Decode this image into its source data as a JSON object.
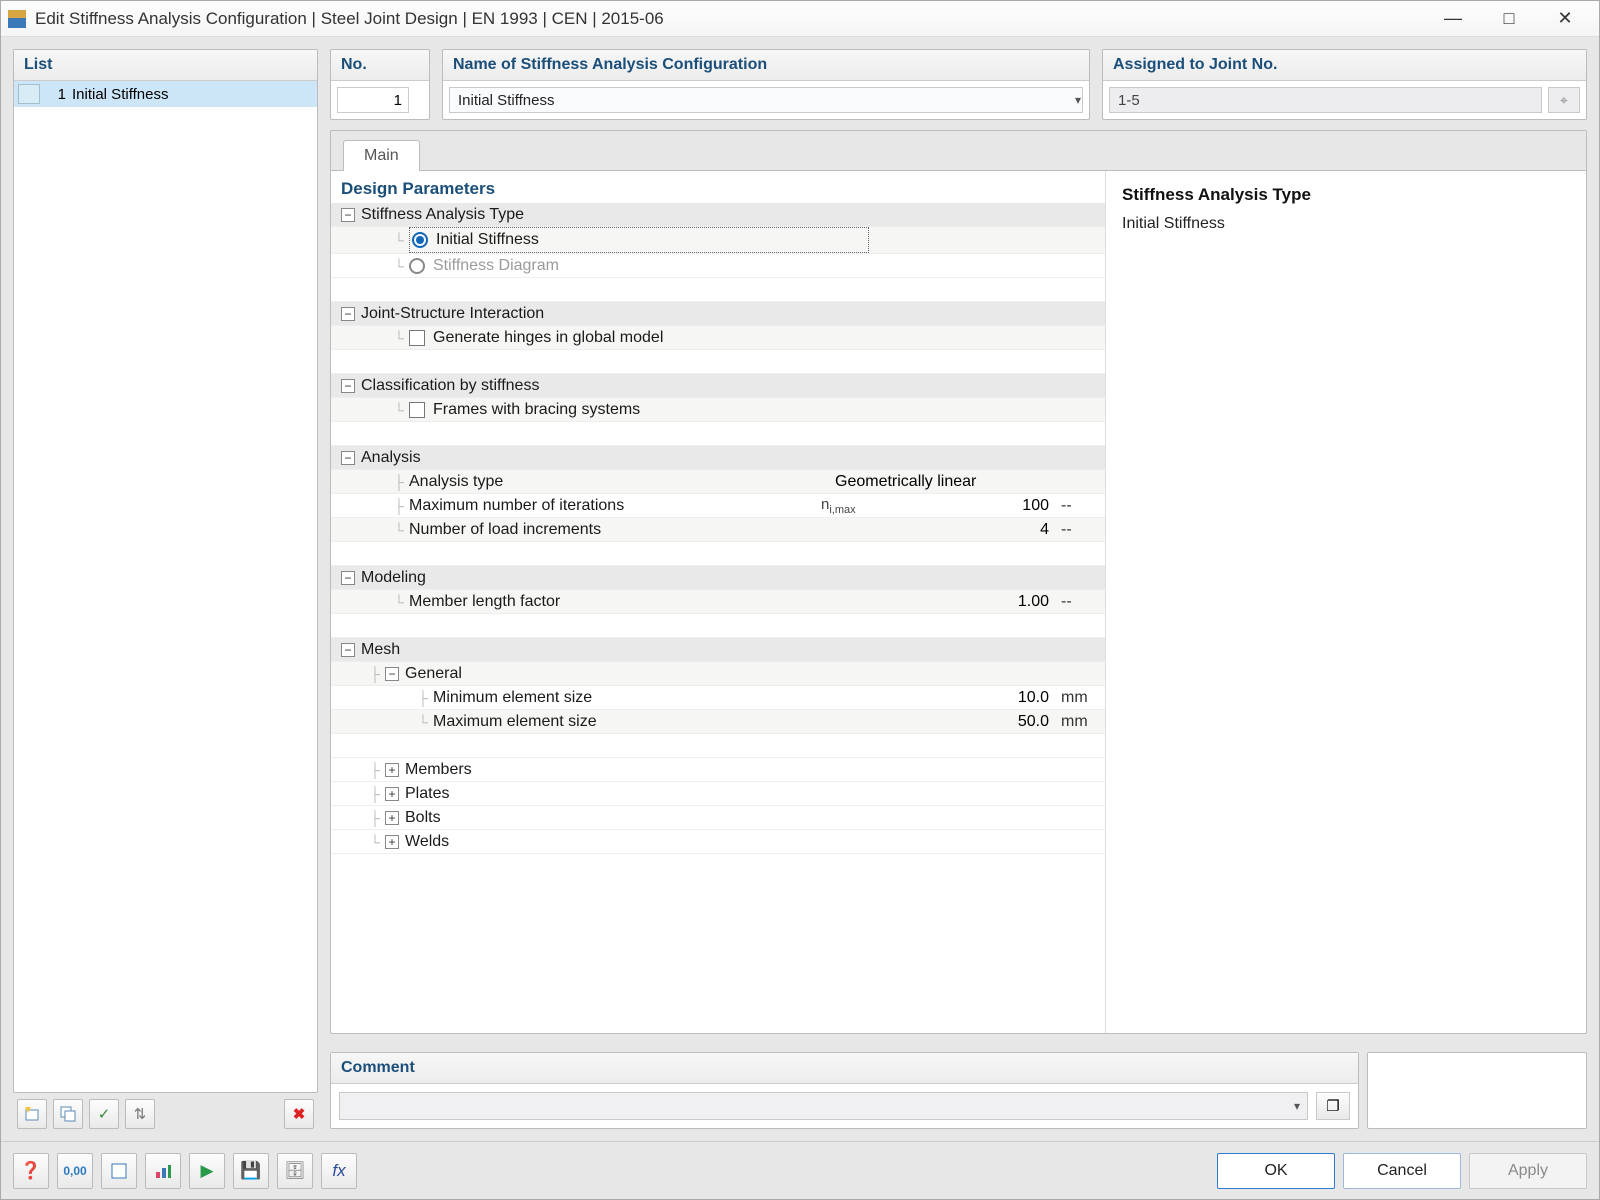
{
  "window": {
    "title": "Edit Stiffness Analysis Configuration | Steel Joint Design | EN 1993 | CEN | 2015-06"
  },
  "left": {
    "header": "List",
    "items": [
      {
        "no": "1",
        "label": "Initial Stiffness"
      }
    ]
  },
  "no": {
    "header": "No.",
    "value": "1"
  },
  "name": {
    "header": "Name of Stiffness Analysis Configuration",
    "value": "Initial Stiffness"
  },
  "assigned": {
    "header": "Assigned to Joint No.",
    "value": "1-5"
  },
  "tabs": {
    "main": "Main"
  },
  "params": {
    "header": "Design Parameters",
    "stiffness_type": {
      "group": "Stiffness Analysis Type",
      "opt1": "Initial Stiffness",
      "opt2": "Stiffness Diagram"
    },
    "joint_interaction": {
      "group": "Joint-Structure Interaction",
      "opt1": "Generate hinges in global model"
    },
    "classification": {
      "group": "Classification by stiffness",
      "opt1": "Frames with bracing systems"
    },
    "analysis": {
      "group": "Analysis",
      "type_label": "Analysis type",
      "type_value": "Geometrically linear",
      "iter_label": "Maximum number of iterations",
      "iter_sym": "nᵢ,max",
      "iter_value": "100",
      "iter_unit": "--",
      "incr_label": "Number of load increments",
      "incr_value": "4",
      "incr_unit": "--"
    },
    "modeling": {
      "group": "Modeling",
      "len_label": "Member length factor",
      "len_value": "1.00",
      "len_unit": "--"
    },
    "mesh": {
      "group": "Mesh",
      "general": "General",
      "min_label": "Minimum element size",
      "min_value": "10.0",
      "min_unit": "mm",
      "max_label": "Maximum element size",
      "max_value": "50.0",
      "max_unit": "mm",
      "members": "Members",
      "plates": "Plates",
      "bolts": "Bolts",
      "welds": "Welds"
    }
  },
  "info": {
    "title": "Stiffness Analysis Type",
    "text": "Initial Stiffness"
  },
  "comment": {
    "header": "Comment",
    "value": ""
  },
  "footer": {
    "ok": "OK",
    "cancel": "Cancel",
    "apply": "Apply"
  }
}
